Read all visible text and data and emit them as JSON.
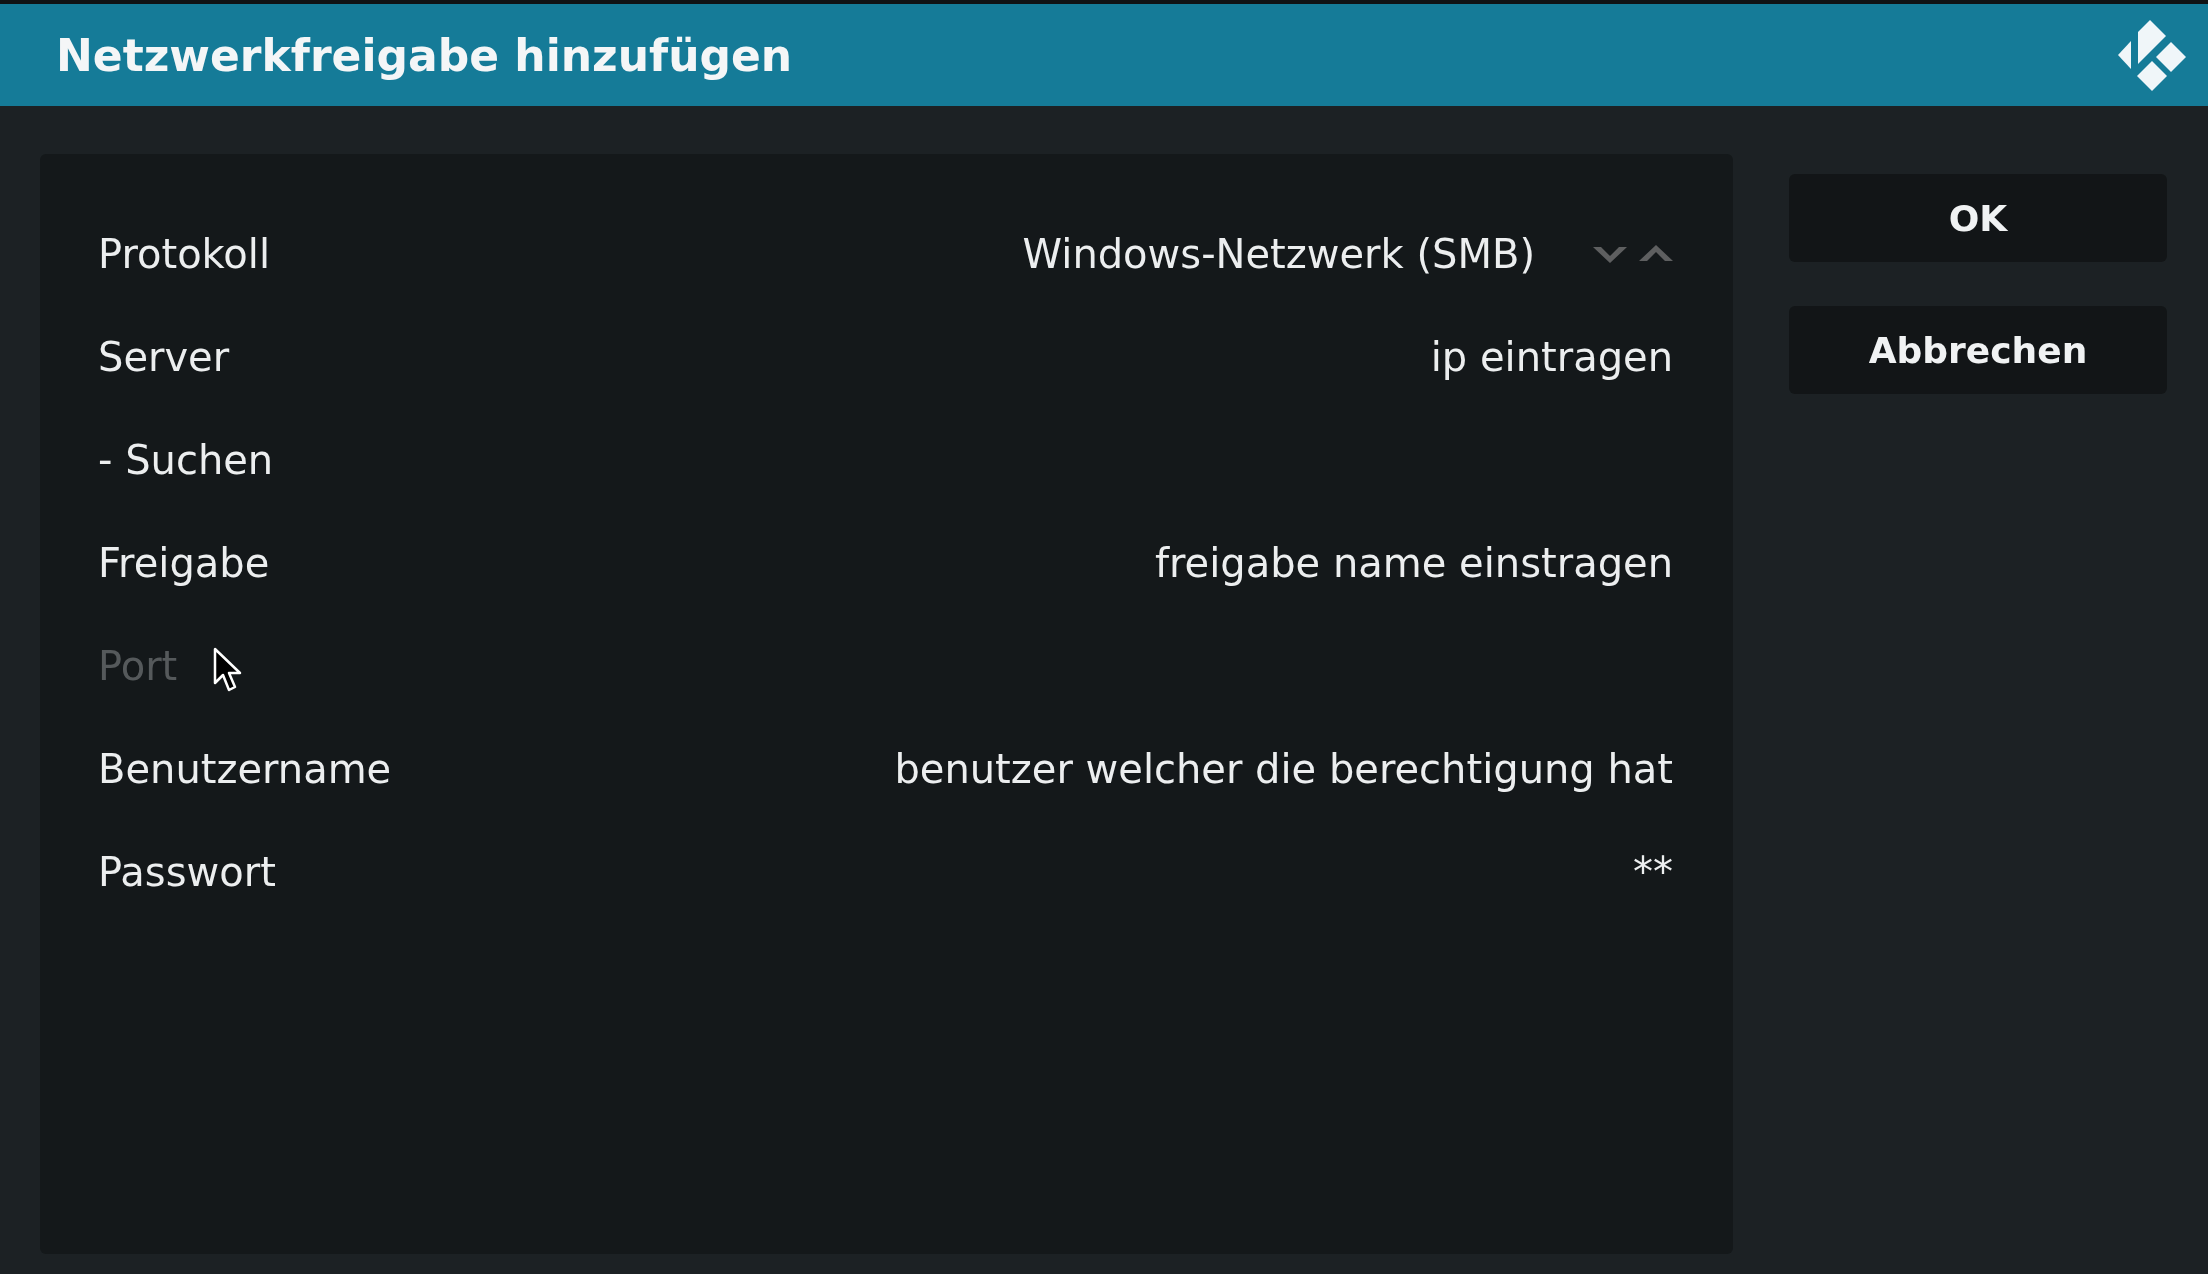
{
  "dialog": {
    "title": "Netzwerkfreigabe hinzufügen"
  },
  "settings": [
    {
      "kind": "spinner",
      "label": "Protokoll",
      "value": "Windows-Netzwerk (SMB)",
      "disabled": false
    },
    {
      "kind": "text",
      "label": "Server",
      "value": "ip eintragen",
      "disabled": false
    },
    {
      "kind": "action",
      "label": "- Suchen",
      "disabled": false
    },
    {
      "kind": "text",
      "label": "Freigabe",
      "value": "freigabe name einstragen",
      "disabled": false
    },
    {
      "kind": "text",
      "label": "Port",
      "disabled": true
    },
    {
      "kind": "text",
      "label": "Benutzername",
      "value": "benutzer welcher die berechtigung hat",
      "disabled": false
    },
    {
      "kind": "text",
      "label": "Passwort",
      "value": "**",
      "disabled": false
    }
  ],
  "buttons": [
    {
      "label": "OK"
    },
    {
      "label": "Abbrechen"
    }
  ]
}
